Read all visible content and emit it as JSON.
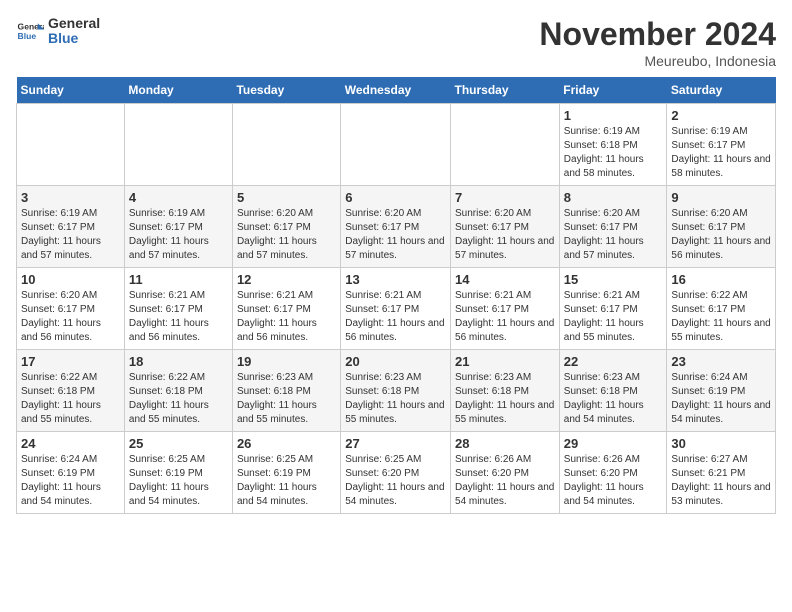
{
  "logo": {
    "line1": "General",
    "line2": "Blue"
  },
  "title": "November 2024",
  "location": "Meureubo, Indonesia",
  "days_header": [
    "Sunday",
    "Monday",
    "Tuesday",
    "Wednesday",
    "Thursday",
    "Friday",
    "Saturday"
  ],
  "weeks": [
    [
      {
        "day": "",
        "info": ""
      },
      {
        "day": "",
        "info": ""
      },
      {
        "day": "",
        "info": ""
      },
      {
        "day": "",
        "info": ""
      },
      {
        "day": "",
        "info": ""
      },
      {
        "day": "1",
        "info": "Sunrise: 6:19 AM\nSunset: 6:18 PM\nDaylight: 11 hours and 58 minutes."
      },
      {
        "day": "2",
        "info": "Sunrise: 6:19 AM\nSunset: 6:17 PM\nDaylight: 11 hours and 58 minutes."
      }
    ],
    [
      {
        "day": "3",
        "info": "Sunrise: 6:19 AM\nSunset: 6:17 PM\nDaylight: 11 hours and 57 minutes."
      },
      {
        "day": "4",
        "info": "Sunrise: 6:19 AM\nSunset: 6:17 PM\nDaylight: 11 hours and 57 minutes."
      },
      {
        "day": "5",
        "info": "Sunrise: 6:20 AM\nSunset: 6:17 PM\nDaylight: 11 hours and 57 minutes."
      },
      {
        "day": "6",
        "info": "Sunrise: 6:20 AM\nSunset: 6:17 PM\nDaylight: 11 hours and 57 minutes."
      },
      {
        "day": "7",
        "info": "Sunrise: 6:20 AM\nSunset: 6:17 PM\nDaylight: 11 hours and 57 minutes."
      },
      {
        "day": "8",
        "info": "Sunrise: 6:20 AM\nSunset: 6:17 PM\nDaylight: 11 hours and 57 minutes."
      },
      {
        "day": "9",
        "info": "Sunrise: 6:20 AM\nSunset: 6:17 PM\nDaylight: 11 hours and 56 minutes."
      }
    ],
    [
      {
        "day": "10",
        "info": "Sunrise: 6:20 AM\nSunset: 6:17 PM\nDaylight: 11 hours and 56 minutes."
      },
      {
        "day": "11",
        "info": "Sunrise: 6:21 AM\nSunset: 6:17 PM\nDaylight: 11 hours and 56 minutes."
      },
      {
        "day": "12",
        "info": "Sunrise: 6:21 AM\nSunset: 6:17 PM\nDaylight: 11 hours and 56 minutes."
      },
      {
        "day": "13",
        "info": "Sunrise: 6:21 AM\nSunset: 6:17 PM\nDaylight: 11 hours and 56 minutes."
      },
      {
        "day": "14",
        "info": "Sunrise: 6:21 AM\nSunset: 6:17 PM\nDaylight: 11 hours and 56 minutes."
      },
      {
        "day": "15",
        "info": "Sunrise: 6:21 AM\nSunset: 6:17 PM\nDaylight: 11 hours and 55 minutes."
      },
      {
        "day": "16",
        "info": "Sunrise: 6:22 AM\nSunset: 6:17 PM\nDaylight: 11 hours and 55 minutes."
      }
    ],
    [
      {
        "day": "17",
        "info": "Sunrise: 6:22 AM\nSunset: 6:18 PM\nDaylight: 11 hours and 55 minutes."
      },
      {
        "day": "18",
        "info": "Sunrise: 6:22 AM\nSunset: 6:18 PM\nDaylight: 11 hours and 55 minutes."
      },
      {
        "day": "19",
        "info": "Sunrise: 6:23 AM\nSunset: 6:18 PM\nDaylight: 11 hours and 55 minutes."
      },
      {
        "day": "20",
        "info": "Sunrise: 6:23 AM\nSunset: 6:18 PM\nDaylight: 11 hours and 55 minutes."
      },
      {
        "day": "21",
        "info": "Sunrise: 6:23 AM\nSunset: 6:18 PM\nDaylight: 11 hours and 55 minutes."
      },
      {
        "day": "22",
        "info": "Sunrise: 6:23 AM\nSunset: 6:18 PM\nDaylight: 11 hours and 54 minutes."
      },
      {
        "day": "23",
        "info": "Sunrise: 6:24 AM\nSunset: 6:19 PM\nDaylight: 11 hours and 54 minutes."
      }
    ],
    [
      {
        "day": "24",
        "info": "Sunrise: 6:24 AM\nSunset: 6:19 PM\nDaylight: 11 hours and 54 minutes."
      },
      {
        "day": "25",
        "info": "Sunrise: 6:25 AM\nSunset: 6:19 PM\nDaylight: 11 hours and 54 minutes."
      },
      {
        "day": "26",
        "info": "Sunrise: 6:25 AM\nSunset: 6:19 PM\nDaylight: 11 hours and 54 minutes."
      },
      {
        "day": "27",
        "info": "Sunrise: 6:25 AM\nSunset: 6:20 PM\nDaylight: 11 hours and 54 minutes."
      },
      {
        "day": "28",
        "info": "Sunrise: 6:26 AM\nSunset: 6:20 PM\nDaylight: 11 hours and 54 minutes."
      },
      {
        "day": "29",
        "info": "Sunrise: 6:26 AM\nSunset: 6:20 PM\nDaylight: 11 hours and 54 minutes."
      },
      {
        "day": "30",
        "info": "Sunrise: 6:27 AM\nSunset: 6:21 PM\nDaylight: 11 hours and 53 minutes."
      }
    ]
  ]
}
